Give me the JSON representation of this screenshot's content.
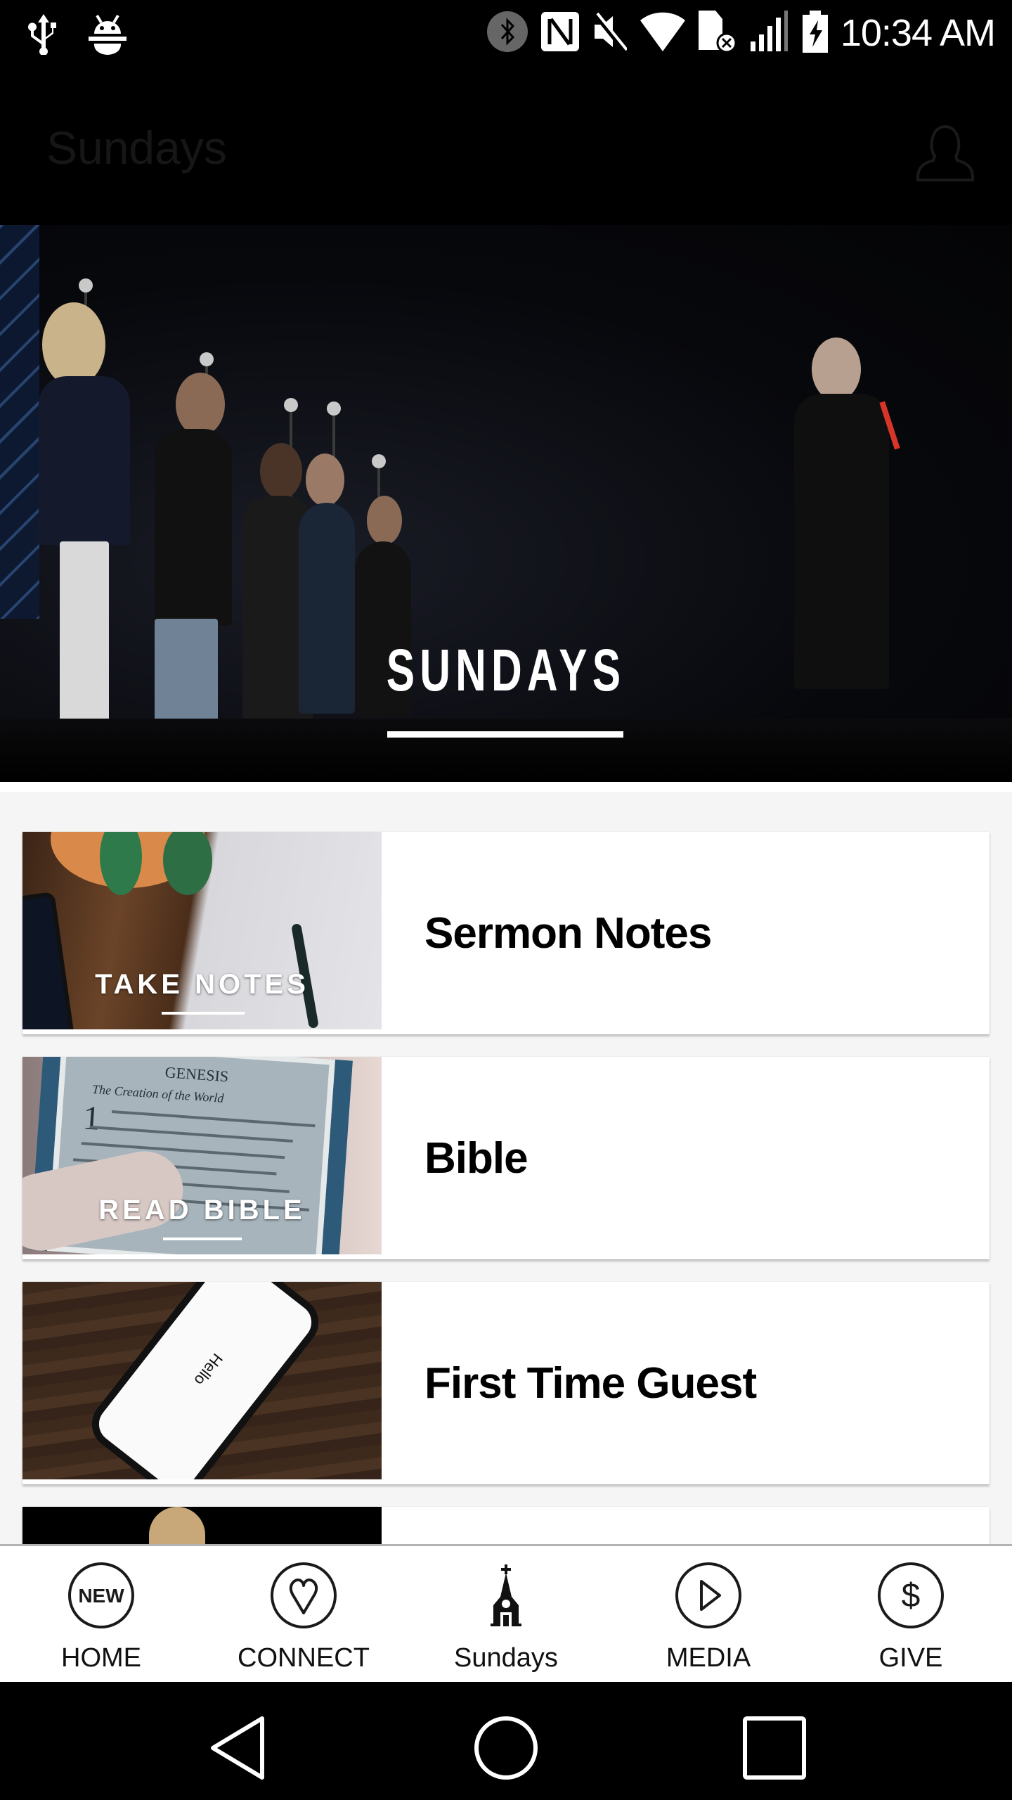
{
  "status_bar": {
    "time": "10:34 AM",
    "left_icons": [
      "usb-icon",
      "android-debug-icon"
    ],
    "right_icons": [
      "bluetooth-icon",
      "nfc-icon",
      "mute-icon",
      "wifi-icon",
      "no-sim-icon",
      "signal-icon",
      "battery-charging-icon"
    ]
  },
  "header": {
    "title": "Sundays",
    "profile_icon": "person-icon"
  },
  "hero": {
    "title": "SUNDAYS"
  },
  "cards": [
    {
      "image_label": "TAKE NOTES",
      "title": "Sermon Notes"
    },
    {
      "image_label": "READ BIBLE",
      "title": "Bible"
    },
    {
      "image_label": "",
      "image_text": "Hello",
      "title": "First Time Guest"
    },
    {
      "image_label": "",
      "title": ""
    }
  ],
  "bible_image_text": {
    "heading": "GENESIS",
    "subheading": "The Creation of the World",
    "verse_number": "1"
  },
  "bottom_nav": {
    "active_index": 2,
    "items": [
      {
        "label": "HOME",
        "icon": "new-badge-icon",
        "icon_text": "NEW"
      },
      {
        "label": "CONNECT",
        "icon": "heart-icon"
      },
      {
        "label": "Sundays",
        "icon": "church-icon"
      },
      {
        "label": "MEDIA",
        "icon": "play-icon"
      },
      {
        "label": "GIVE",
        "icon": "dollar-icon"
      }
    ]
  },
  "system_nav": [
    "back-icon",
    "home-icon",
    "recents-icon"
  ]
}
